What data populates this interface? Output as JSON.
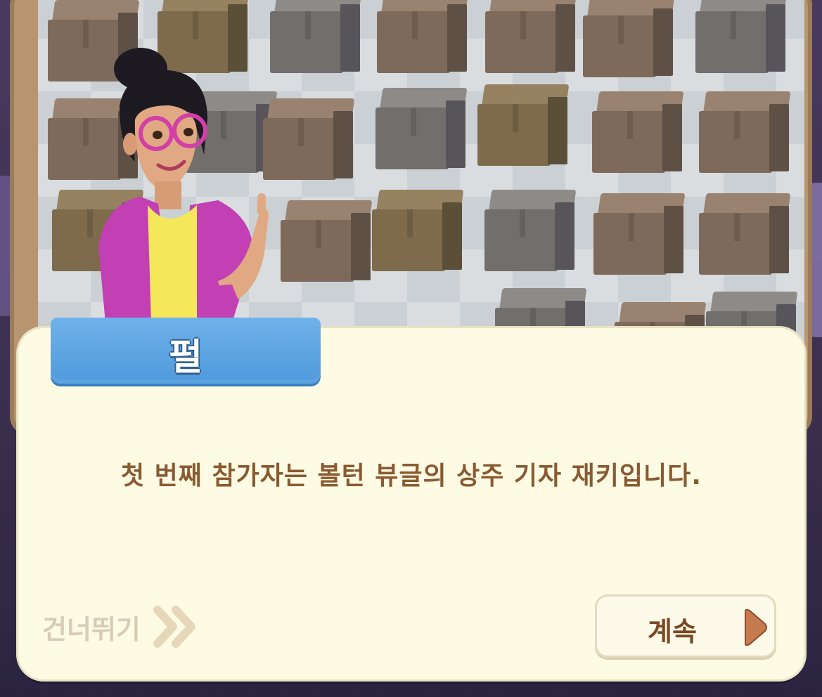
{
  "dialog": {
    "speaker_name": "펄",
    "message": "첫 번째 참가자는 볼턴 뷰글의 상주 기자 재키입니다.",
    "skip_label": "건너뛰기",
    "continue_label": "계속"
  },
  "colors": {
    "dialog_bg": "#fdfbe3",
    "name_tag": "#5aa2e0",
    "message_text": "#8a5a32",
    "skip_text": "#d9ccb4",
    "continue_text": "#7a4a22"
  }
}
